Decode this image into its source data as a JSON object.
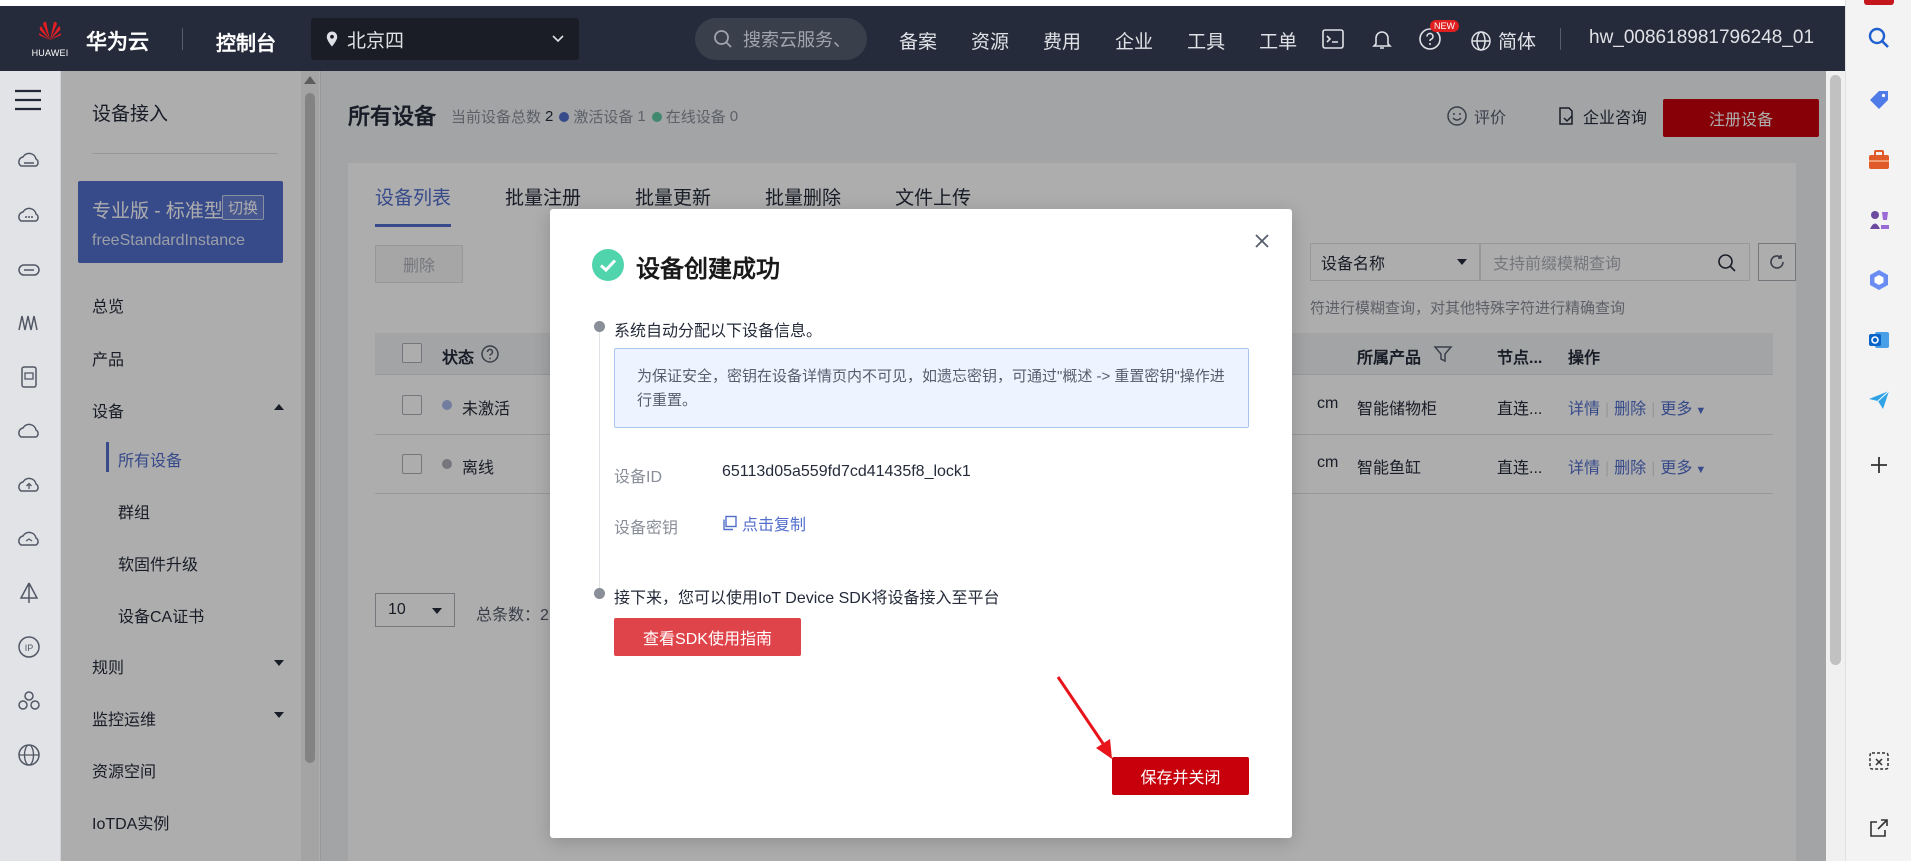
{
  "topbar": {
    "logo_text": "HUAWEI",
    "brand": "华为云",
    "console": "控制台",
    "region": "北京四",
    "search_placeholder": "搜索云服务、",
    "nav": [
      "备案",
      "资源",
      "费用",
      "企业",
      "工具",
      "工单"
    ],
    "new_badge": "NEW",
    "language": "简体",
    "username": "hw_008618981796248_01"
  },
  "sidebar": {
    "title": "设备接入",
    "edition": {
      "name": "专业版 - 标准型",
      "switch_label": "切换",
      "instance": "freeStandardInstance"
    },
    "items": {
      "overview": "总览",
      "product": "产品",
      "device": "设备",
      "all_devices": "所有设备",
      "group": "群组",
      "firmware": "软固件升级",
      "ca_cert": "设备CA证书",
      "rules": "规则",
      "monitoring": "监控运维",
      "resource_space": "资源空间",
      "iotda_instance": "IoTDA实例"
    }
  },
  "page": {
    "title": "所有设备",
    "stats": {
      "total_label": "当前设备总数",
      "total": "2",
      "active_label": "激活设备",
      "active": "1",
      "online_label": "在线设备",
      "online": "0"
    },
    "evaluate": "评价",
    "consult": "企业咨询",
    "register_button": "注册设备"
  },
  "tabs": [
    "设备列表",
    "批量注册",
    "批量更新",
    "批量删除",
    "文件上传"
  ],
  "toolbar": {
    "delete_button": "删除",
    "filter_field": "设备名称",
    "filter_placeholder": "支持前缀模糊查询",
    "hint": "符进行模糊查询，对其他特殊字符进行精确查询"
  },
  "table": {
    "headers": {
      "status": "状态",
      "product": "所属产品",
      "node": "节点...",
      "actions": "操作"
    },
    "rows": [
      {
        "status": "未激活",
        "status_color": "#a9b9ea",
        "frag": "cm",
        "product": "智能储物柜",
        "node": "直连...",
        "detail": "详情",
        "delete": "删除",
        "more": "更多"
      },
      {
        "status": "离线",
        "status_color": "#adb0b8",
        "frag": "cm",
        "product": "智能鱼缸",
        "node": "直连...",
        "detail": "详情",
        "delete": "删除",
        "more": "更多"
      }
    ]
  },
  "pagination": {
    "page_size": "10",
    "total_label": "总条数：2"
  },
  "dialog": {
    "title": "设备创建成功",
    "step1": "系统自动分配以下设备信息。",
    "notice": "为保证安全，密钥在设备详情页内不可见，如遗忘密钥，可通过\"概述 -> 重置密钥\"操作进行重置。",
    "device_id_label": "设备ID",
    "device_id": "65113d05a559fd7cd41435f8_lock1",
    "secret_label": "设备密钥",
    "copy_label": "点击复制",
    "step2": "接下来，您可以使用IoT Device SDK将设备接入至平台",
    "sdk_button": "查看SDK使用指南",
    "save_button": "保存并关闭"
  },
  "colors": {
    "brand_red": "#c7000b",
    "accent_blue": "#526ecc",
    "success_green": "#50d4ab",
    "topbar_bg": "#252b3a",
    "active_dot": "#526ecc",
    "online_dot": "#5dc9a3"
  },
  "icons": {
    "rail": [
      "menu-icon",
      "cloud-server-icon",
      "cloud-icon",
      "router-icon",
      "wave-icon",
      "document-icon",
      "cloud-outline-icon",
      "cloud-upload-icon",
      "cloud-sync-icon",
      "sail-icon",
      "ip-icon",
      "cluster-icon",
      "globe-icon"
    ],
    "edge": [
      "search-icon",
      "tag-icon",
      "briefcase-icon",
      "chess-icon",
      "copilot-icon",
      "outlook-icon",
      "paper-plane-icon",
      "plus-icon",
      "screenshot-icon",
      "external-link-icon"
    ]
  }
}
